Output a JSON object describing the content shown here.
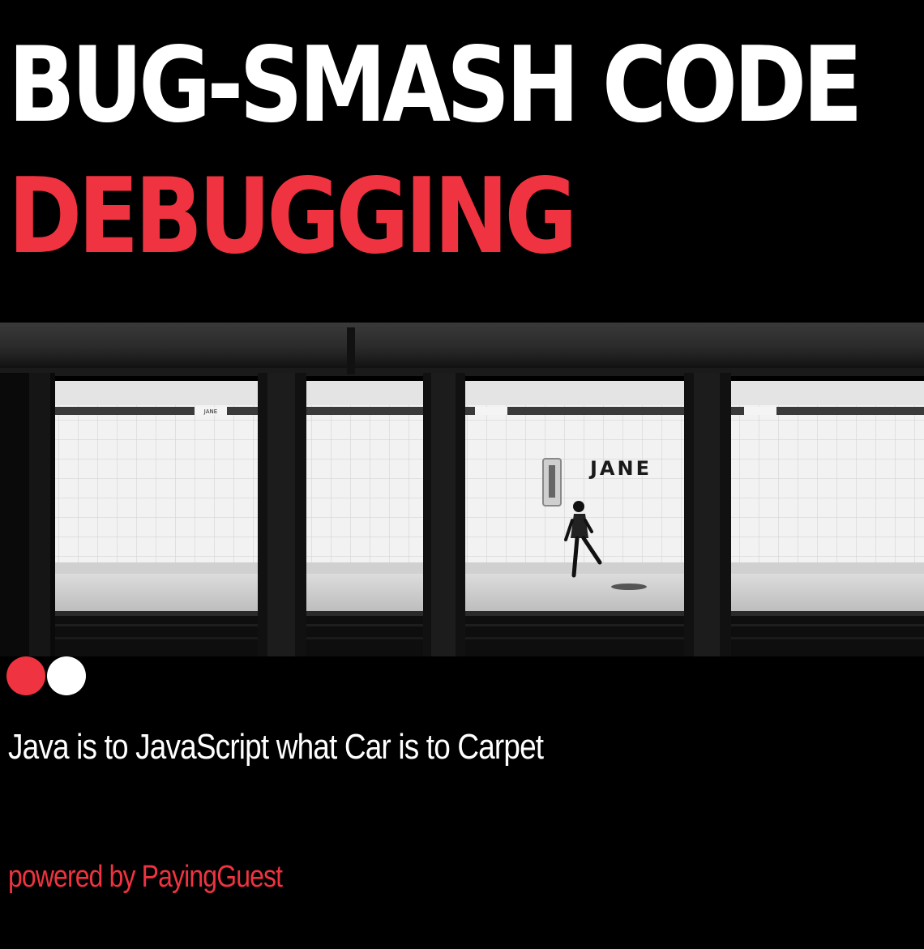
{
  "poster": {
    "title_line1": "BUG-SMASH CODE",
    "title_line2": "DEBUGGING",
    "tagline": "Java is to JavaScript what Car is to Carpet",
    "powered_by": "powered by PayingGuest"
  },
  "photo": {
    "station_sign": "JANE",
    "small_sign": "JANE"
  },
  "colors": {
    "background": "#000000",
    "title_white": "#ffffff",
    "accent_red": "#ef3340",
    "dot_white": "#ffffff"
  }
}
